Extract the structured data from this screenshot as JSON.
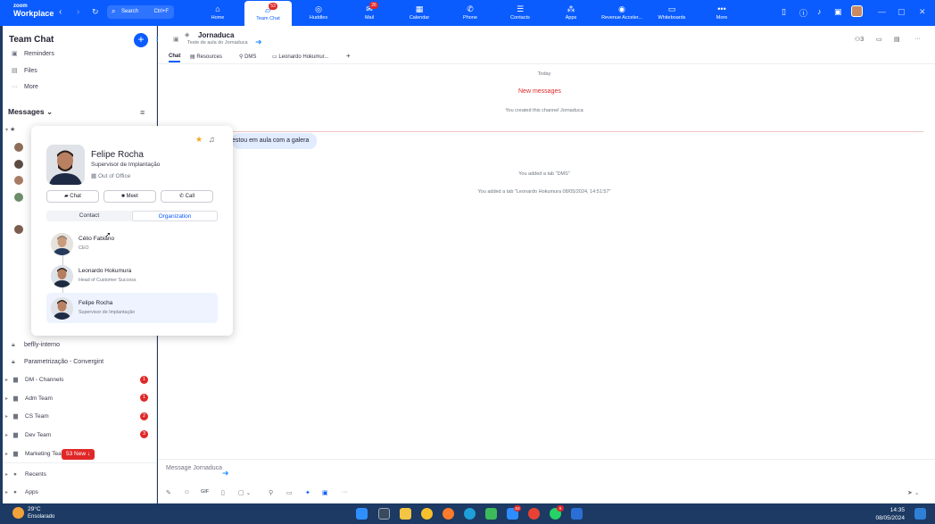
{
  "topbar": {
    "logo_line1": "zoom",
    "logo_line2": "Workplace",
    "search_label": "Search",
    "search_shortcut": "Ctrl+F",
    "nav": [
      {
        "label": "Home",
        "icon": "home-icon",
        "glyph": "⌂"
      },
      {
        "label": "Team Chat",
        "icon": "chat-icon",
        "glyph": "💬",
        "badge": "53",
        "active": true
      },
      {
        "label": "Huddles",
        "icon": "huddles-icon",
        "glyph": "◎"
      },
      {
        "label": "Mail",
        "icon": "mail-icon",
        "glyph": "✉",
        "badge": "26"
      },
      {
        "label": "Calendar",
        "icon": "calendar-icon",
        "glyph": "▦"
      },
      {
        "label": "Phone",
        "icon": "phone-icon",
        "glyph": "✆"
      },
      {
        "label": "Contacts",
        "icon": "contacts-icon",
        "glyph": "☰"
      },
      {
        "label": "Apps",
        "icon": "apps-icon",
        "glyph": "⁂"
      },
      {
        "label": "Revenue Acceler...",
        "icon": "revenue-icon",
        "glyph": "◉"
      },
      {
        "label": "Whiteboards",
        "icon": "whiteboard-icon",
        "glyph": "▭"
      },
      {
        "label": "More",
        "icon": "more-icon",
        "glyph": "•••"
      }
    ]
  },
  "sidebar": {
    "title": "Team Chat",
    "top_items": [
      {
        "label": "Reminders",
        "icon": "reminder-icon"
      },
      {
        "label": "Files",
        "icon": "file-icon"
      },
      {
        "label": "More",
        "icon": "more-dots-icon"
      }
    ],
    "messages_header": "Messages",
    "channels": [
      {
        "label": "beflly-interno"
      },
      {
        "label": "Parametrização - Convergint"
      }
    ],
    "groups": [
      {
        "label": "DM - Channels",
        "badge": "1"
      },
      {
        "label": "Adm Team",
        "badge": "1"
      },
      {
        "label": "CS Team",
        "badge": "2"
      },
      {
        "label": "Dev Team",
        "badge": "3"
      },
      {
        "label": "Marketing Team",
        "badge": ""
      }
    ],
    "new_pill": "53 New",
    "bottom_items": [
      {
        "label": "Recents"
      },
      {
        "label": "Apps"
      }
    ]
  },
  "channel": {
    "name": "Jornaduca",
    "description": "Teste de aula do Jornaduca",
    "tabs": [
      "Chat",
      "Resources",
      "DMS",
      "Leonardo Hokumur..."
    ],
    "member_count": "3",
    "date_divider": "Today",
    "new_messages_label": "New messages",
    "system_notes": [
      "You created this channel Jornaduca",
      "You added a tab \"DMS\"",
      "You added a tab \"Leonardo Hokumura 08/05/2024, 14:51:57\""
    ],
    "bubble_text": "estou em aula com a galera",
    "composer_placeholder": "Message Jornaduca"
  },
  "profile_card": {
    "name": "Felipe Rocha",
    "role": "Supervisor de Implantação",
    "status": "Out of Office",
    "buttons": [
      "Chat",
      "Meet",
      "Call"
    ],
    "tabs": [
      "Contact",
      "Organization"
    ],
    "active_tab": "Organization",
    "org": [
      {
        "name": "Célio Fabiano",
        "role": "CEO"
      },
      {
        "name": "Leonardo Hokumura",
        "role": "Head of Customer Success"
      },
      {
        "name": "Felipe Rocha",
        "role": "Supervisor de Implantação"
      }
    ]
  },
  "taskbar": {
    "temperature": "29°C",
    "weather": "Ensolarado",
    "zoom_badge": "53",
    "whatsapp_badge": "6",
    "time": "14:35",
    "date": "08/05/2024"
  },
  "colors": {
    "brand": "#0b5cff",
    "badge": "#e02828",
    "new_messages": "#e02828",
    "bubble": "#e1ecff"
  }
}
